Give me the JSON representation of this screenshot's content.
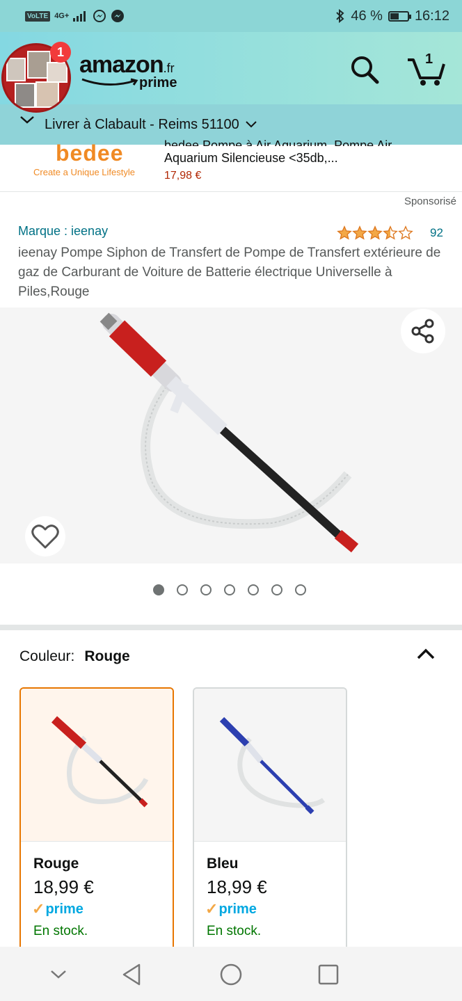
{
  "status_bar": {
    "volte": "VoLTE",
    "network": "4G+",
    "battery_percent": "46 %",
    "battery_level": 0.46,
    "time": "16:12"
  },
  "header": {
    "logo_text": "amazon",
    "logo_suffix": ".fr",
    "logo_prime": "prime",
    "cart_count": "1",
    "deliver_to": "Livrer à Clabault - Reims 51100"
  },
  "bubble": {
    "badge": "1"
  },
  "ad": {
    "brand_logo": "bedee",
    "tagline": "Create a Unique Lifestyle",
    "title_cut": "bedee Pompe à Air Aquarium, Pompe Air",
    "title": "Aquarium Silencieuse <35db,...",
    "price": "17,98 €"
  },
  "sponsored_label": "Sponsorisé",
  "product": {
    "brand": "Marque : ieenay",
    "rating_stars": 3.5,
    "rating_count": "92",
    "title": "ieenay Pompe Siphon de Transfert de Pompe de Transfert extérieure de gaz de Carburant de Voiture de Batterie électrique Universelle à Piles,Rouge",
    "image_count": 7,
    "active_image": 0
  },
  "color_selector": {
    "label": "Couleur:",
    "selected": "Rouge",
    "options": [
      {
        "name": "Rouge",
        "price": "18,99 €",
        "prime": "prime",
        "stock": "En stock.",
        "color": "#c8201e"
      },
      {
        "name": "Bleu",
        "price": "18,99 €",
        "prime": "prime",
        "stock": "En stock.",
        "color": "#2c3fb0"
      }
    ]
  },
  "colors": {
    "header_bg": "#84d8e2",
    "link": "#007185",
    "price": "#b12704",
    "stock": "#007600",
    "prime": "#00a8e1",
    "star": "#f3a847",
    "selected_border": "#e77600"
  }
}
